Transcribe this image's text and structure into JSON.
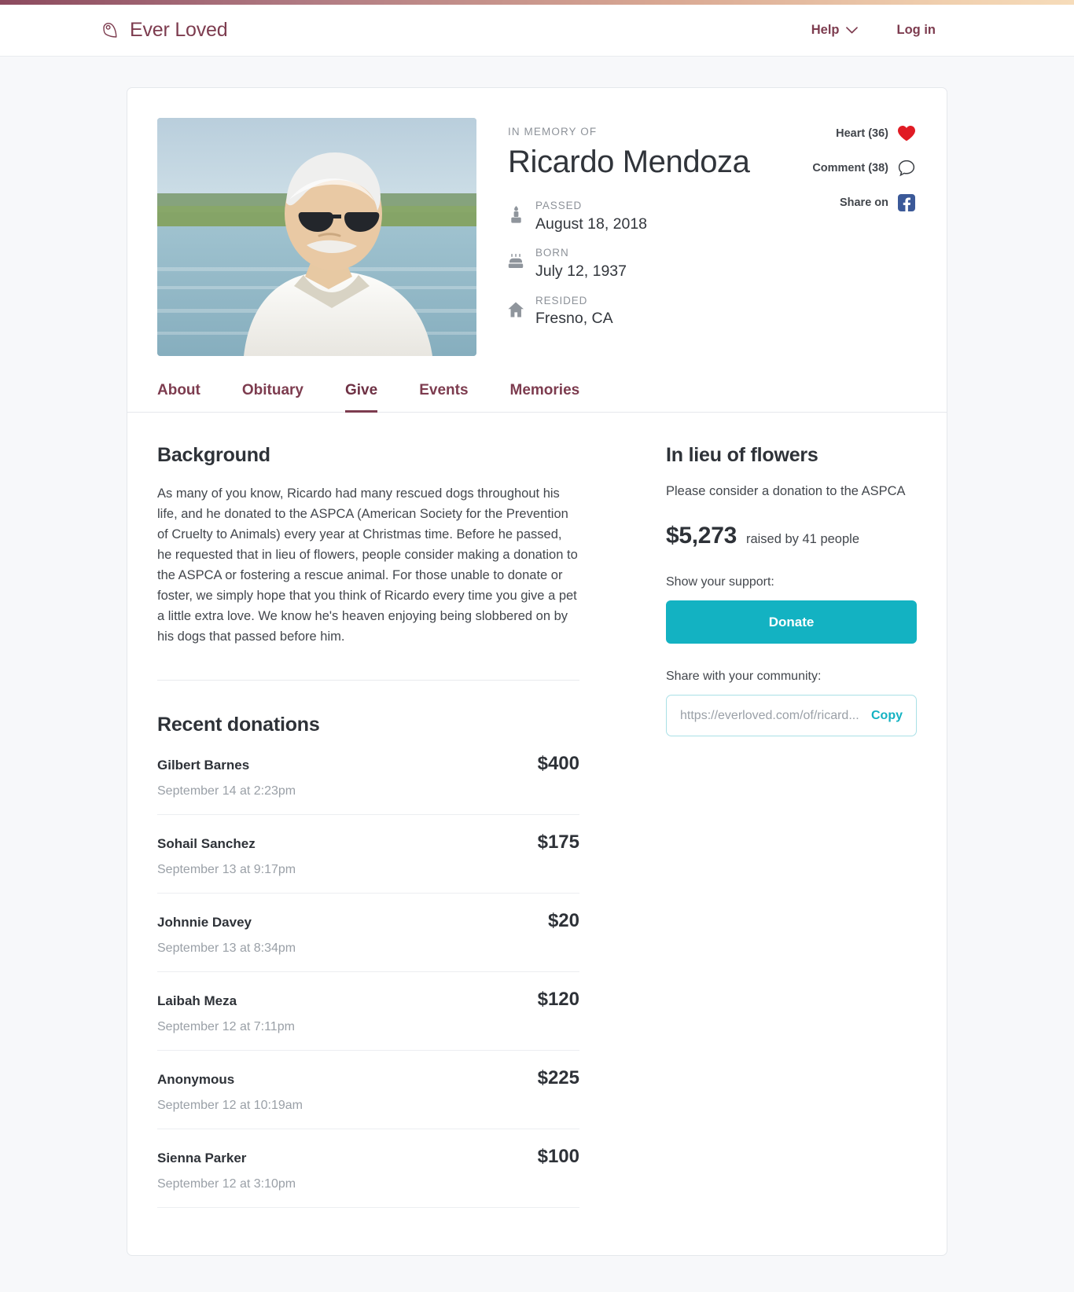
{
  "topbar": {
    "gradient_from": "#8c4a5e",
    "gradient_to": "#f6dcba"
  },
  "header": {
    "brand": "Ever Loved",
    "brand_icon": "heart-leaf-logo-icon",
    "brand_color": "#7d3c4f",
    "help_label": "Help",
    "help_icon": "chevron-down-icon",
    "login_label": "Log in"
  },
  "profile": {
    "photo_alt": "portrait-of-older-man-with-sunglasses-by-water",
    "eyebrow": "IN MEMORY OF",
    "name": "Ricardo Mendoza",
    "facts": [
      {
        "icon": "candle-icon",
        "label": "PASSED",
        "value": "August 18, 2018"
      },
      {
        "icon": "birthday-cake-icon",
        "label": "BORN",
        "value": "July 12, 1937"
      },
      {
        "icon": "house-icon",
        "label": "RESIDED",
        "value": "Fresno, CA"
      }
    ],
    "engagement": [
      {
        "label": "Heart (36)",
        "icon": "heart-icon",
        "color": "#e01b24"
      },
      {
        "label": "Comment (38)",
        "icon": "comment-bubble-icon",
        "color": "#3b3f45"
      },
      {
        "label": "Share on",
        "icon": "facebook-icon",
        "color": "#3b5998"
      }
    ]
  },
  "tabs": [
    {
      "label": "About",
      "active": false
    },
    {
      "label": "Obituary",
      "active": false
    },
    {
      "label": "Give",
      "active": true
    },
    {
      "label": "Events",
      "active": false
    },
    {
      "label": "Memories",
      "active": false
    }
  ],
  "background_section": {
    "title": "Background",
    "text": "As many of you know, Ricardo had many rescued dogs throughout his life, and he donated to the ASPCA (American Society for the Prevention of Cruelty to Animals) every year at Christmas time. Before he passed, he requested that in lieu of flowers, people consider making a donation to the ASPCA or fostering a rescue animal. For those unable to donate or foster, we simply hope that you think of Ricardo every time you give a pet a little extra love. We know he's heaven enjoying being slobbered on by his dogs that passed before him."
  },
  "donations_section": {
    "title": "Recent donations",
    "rows": [
      {
        "name": "Gilbert Barnes",
        "amount": "$400",
        "date": "September 14 at 2:23pm"
      },
      {
        "name": "Sohail Sanchez",
        "amount": "$175",
        "date": "September 13 at 9:17pm"
      },
      {
        "name": "Johnnie Davey",
        "amount": "$20",
        "date": "September 13 at 8:34pm"
      },
      {
        "name": "Laibah Meza",
        "amount": "$120",
        "date": "September 12 at 7:11pm"
      },
      {
        "name": "Anonymous",
        "amount": "$225",
        "date": "September 12 at 10:19am"
      },
      {
        "name": "Sienna Parker",
        "amount": "$100",
        "date": "September 12 at 3:10pm"
      }
    ]
  },
  "lieu_section": {
    "title": "In lieu of flowers",
    "subtitle": "Please consider a donation to the ASPCA",
    "raised_amount": "$5,273",
    "raised_by": "raised by 41 people",
    "support_label": "Show your support:",
    "donate_label": "Donate",
    "share_label": "Share with your community:",
    "share_placeholder": "https://everloved.com/of/ricard...",
    "copy_label": "Copy",
    "accent_color": "#13b2c2"
  }
}
